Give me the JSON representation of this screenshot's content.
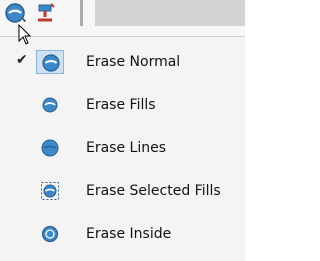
{
  "toolbar": {
    "eraser_button_icon": "eraser-icon",
    "paint_button_icon": "paint-bucket-icon"
  },
  "menu": {
    "items": [
      {
        "label": "Erase Normal",
        "icon": "erase-normal-icon",
        "checked": true
      },
      {
        "label": "Erase Fills",
        "icon": "erase-fills-icon",
        "checked": false
      },
      {
        "label": "Erase Lines",
        "icon": "erase-lines-icon",
        "checked": false
      },
      {
        "label": "Erase Selected Fills",
        "icon": "erase-selected-fills-icon",
        "checked": false
      },
      {
        "label": "Erase Inside",
        "icon": "erase-inside-icon",
        "checked": false
      }
    ],
    "check_glyph": "✔"
  },
  "colors": {
    "accent": "#3d88c8",
    "accent_dark": "#2a5f8e",
    "selection_bg": "#cfe0f3",
    "menu_bg": "#f4f4f4"
  }
}
